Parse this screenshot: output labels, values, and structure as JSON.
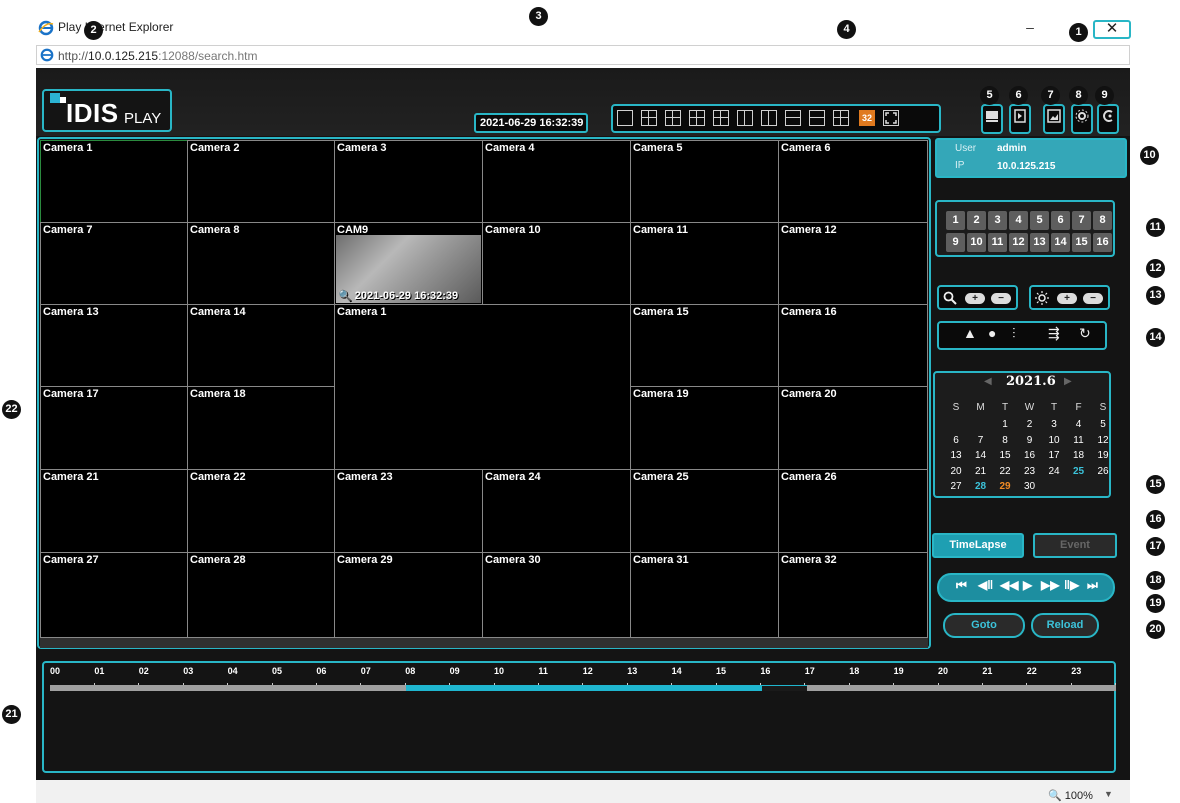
{
  "window": {
    "title": "Play Internet Explorer",
    "minimize_glyph": "–",
    "close_glyph": "✕"
  },
  "address": {
    "prefix": "http://",
    "host": "10.0.125.215",
    "rest": ":12088/search.htm"
  },
  "logo": {
    "brand": "IDIS",
    "product": "PLAY"
  },
  "datetime": "2021-06-29 16:32:39",
  "layout_buttons": [
    "1x1",
    "2x2",
    "3x3",
    "4x4",
    "5x5",
    "split-2",
    "split-3",
    "1+5",
    "1+7",
    "custom",
    "32",
    "fullscreen"
  ],
  "layout_active_label": "32",
  "tools": [
    "snapshot-icon",
    "export-icon",
    "image-icon",
    "settings-icon",
    "live-icon"
  ],
  "callouts": {
    "close": "1",
    "logo": "2",
    "datetime": "3",
    "layouts": "4",
    "t5": "5",
    "t6": "6",
    "t7": "7",
    "t8": "8",
    "t9": "9",
    "user": "10",
    "channels": "11",
    "zoom": "12",
    "brightness": "13",
    "ptz": "14",
    "calendar": "15",
    "timelapse": "16",
    "event": "17",
    "transport": "18",
    "goto": "19",
    "reload": "20",
    "timeline": "21",
    "grid": "22"
  },
  "cameras": {
    "c1": "Camera 1",
    "c2": "Camera 2",
    "c3": "Camera 3",
    "c4": "Camera 4",
    "c5": "Camera 5",
    "c6": "Camera 6",
    "c7": "Camera 7",
    "c8": "Camera 8",
    "c9": "CAM9",
    "c10": "Camera 10",
    "c11": "Camera 11",
    "c12": "Camera 12",
    "c13": "Camera 13",
    "c14": "Camera 14",
    "big": "Camera 1",
    "c15": "Camera 15",
    "c16": "Camera 16",
    "c17": "Camera 17",
    "c18": "Camera 18",
    "c19": "Camera 19",
    "c20": "Camera 20",
    "c21": "Camera 21",
    "c22": "Camera 22",
    "c23": "Camera 23",
    "c24": "Camera 24",
    "c25": "Camera 25",
    "c26": "Camera 26",
    "c27": "Camera 27",
    "c28": "Camera 28",
    "c29": "Camera 29",
    "c30": "Camera 30",
    "c31": "Camera 31",
    "c32": "Camera 32"
  },
  "cam9_timestamp": "2021-06-29 16:32:39",
  "user": {
    "user_label": "User",
    "user_value": "admin",
    "ip_label": "IP",
    "ip_value": "10.0.125.215"
  },
  "channels": [
    "1",
    "2",
    "3",
    "4",
    "5",
    "6",
    "7",
    "8",
    "9",
    "10",
    "11",
    "12",
    "13",
    "14",
    "15",
    "16"
  ],
  "zoom_ctrl": {
    "plus": "+",
    "minus": "−"
  },
  "brightness_ctrl": {
    "plus": "+",
    "minus": "−"
  },
  "calendar": {
    "title": "2021.6",
    "weekdays": [
      "S",
      "M",
      "T",
      "W",
      "T",
      "F",
      "S"
    ],
    "rows": [
      [
        "",
        "",
        "1",
        "2",
        "3",
        "4",
        "5"
      ],
      [
        "6",
        "7",
        "8",
        "9",
        "10",
        "11",
        "12"
      ],
      [
        "13",
        "14",
        "15",
        "16",
        "17",
        "18",
        "19"
      ],
      [
        "20",
        "21",
        "22",
        "23",
        "24",
        "25",
        "26"
      ],
      [
        "27",
        "28",
        "29",
        "30",
        "",
        "",
        ""
      ]
    ],
    "highlight_cyan": [
      "25",
      "28"
    ],
    "highlight_orange": [
      "29"
    ]
  },
  "buttons": {
    "timelapse": "TimeLapse",
    "event": "Event",
    "goto": "Goto",
    "reload": "Reload"
  },
  "transport_icons": [
    "first-icon",
    "step-back-icon",
    "rewind-icon",
    "play-icon",
    "fast-forward-icon",
    "step-forward-icon",
    "last-icon"
  ],
  "timeline": {
    "hours": [
      "00",
      "01",
      "02",
      "03",
      "04",
      "05",
      "06",
      "07",
      "08",
      "09",
      "10",
      "11",
      "12",
      "13",
      "14",
      "15",
      "16",
      "17",
      "18",
      "19",
      "20",
      "21",
      "22",
      "23"
    ],
    "recorded_from_hour": 8,
    "recorded_to_hour": 16,
    "gap_from_hour": 16,
    "gap_to_hour": 17
  },
  "status": {
    "zoom": "100%"
  },
  "colors": {
    "accent": "#29b6c6",
    "active_layout": "#e07a1f",
    "record_bar": "#1fb6cf"
  }
}
